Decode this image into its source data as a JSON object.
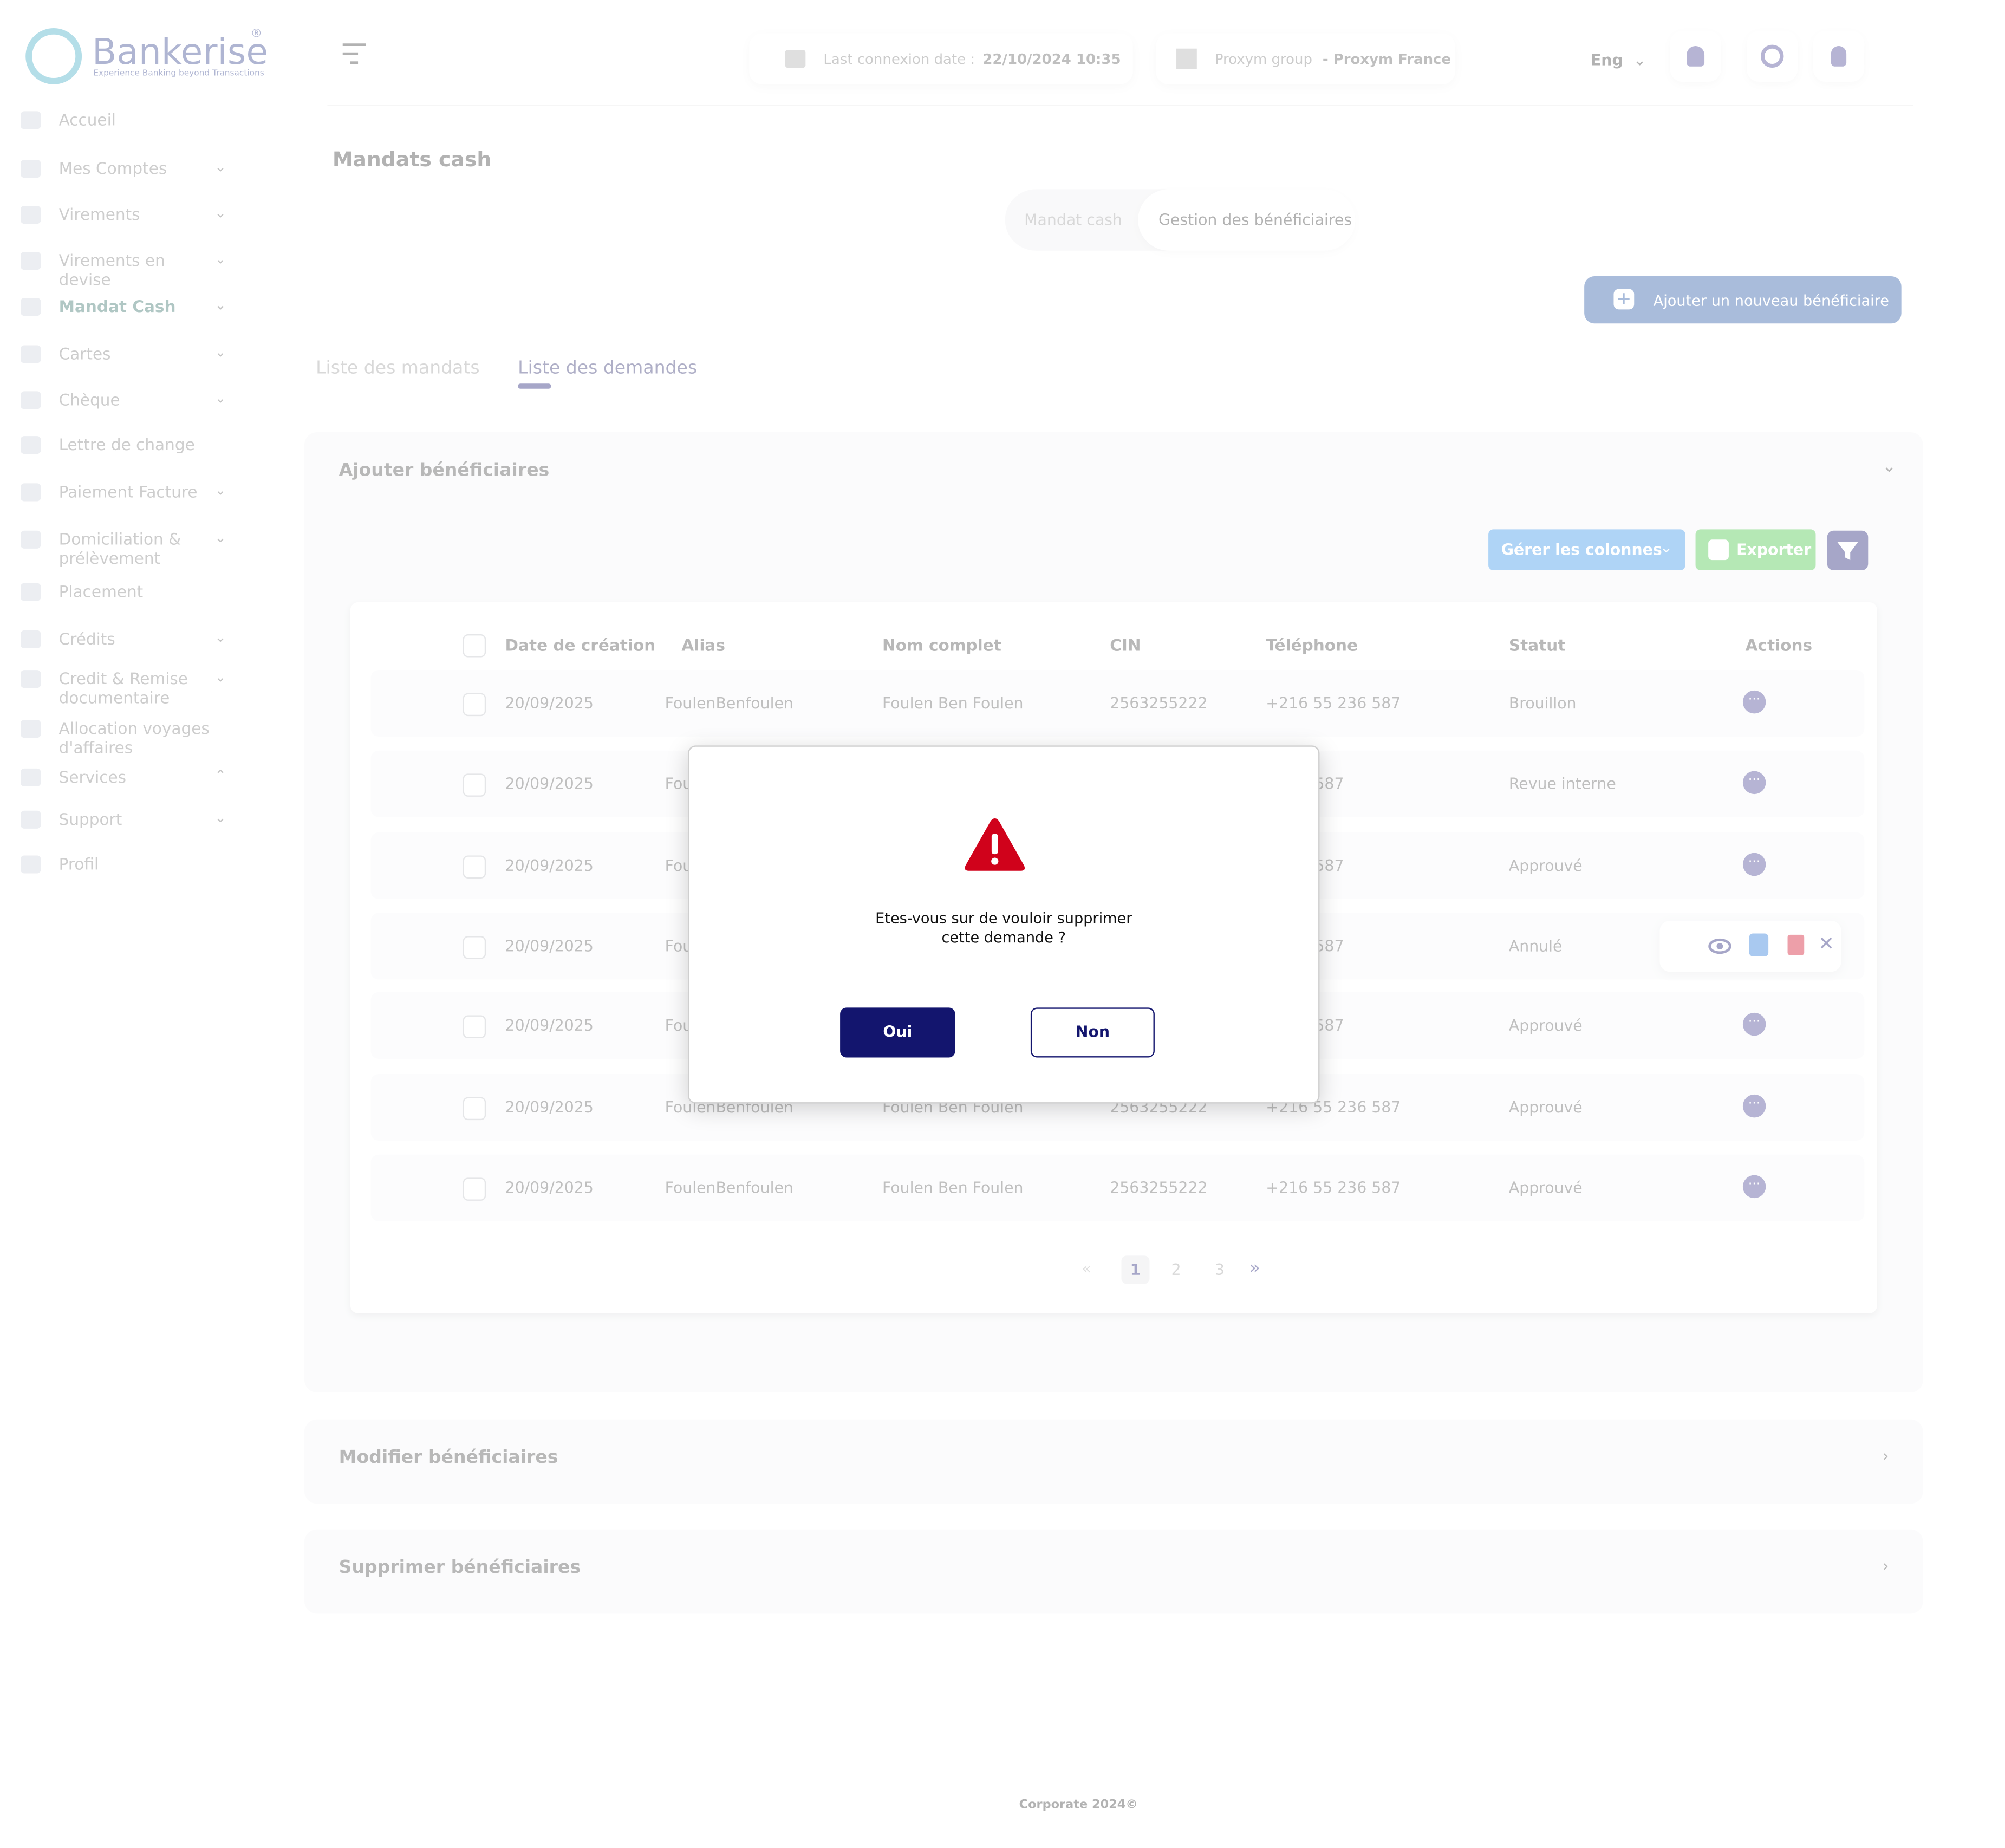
{
  "brand": {
    "name": "Bankerise",
    "tagline": "Experience Banking beyond Transactions",
    "registered": "®"
  },
  "sidebar": {
    "items": [
      {
        "label": "Accueil",
        "chev": ""
      },
      {
        "label": "Mes Comptes",
        "chev": "⌄"
      },
      {
        "label": "Virements",
        "chev": "⌄"
      },
      {
        "label": "Virements en devise",
        "chev": "⌄"
      },
      {
        "label": "Mandat Cash",
        "chev": "⌄"
      },
      {
        "label": "Cartes",
        "chev": "⌄"
      },
      {
        "label": "Chèque",
        "chev": "⌄"
      },
      {
        "label": "Lettre de change",
        "chev": ""
      },
      {
        "label": "Paiement Facture",
        "chev": "⌄"
      },
      {
        "label": "Domiciliation & prélèvement",
        "chev": "⌄"
      },
      {
        "label": "Placement",
        "chev": ""
      },
      {
        "label": "Crédits",
        "chev": "⌄"
      },
      {
        "label": "Credit & Remise documentaire",
        "chev": "⌄"
      },
      {
        "label": "Allocation voyages d'affaires",
        "chev": ""
      },
      {
        "label": "Services",
        "chev": "⌃"
      },
      {
        "label": "Support",
        "chev": "⌄"
      },
      {
        "label": "Profil",
        "chev": ""
      }
    ]
  },
  "header": {
    "last_connexion_label": "Last connexion date :",
    "last_connexion_value": "22/10/2024 10:35",
    "group_label": "Proxym group",
    "group_value": "- Proxym France",
    "language": "Eng"
  },
  "page": {
    "title": "Mandats cash",
    "segment_tabs": [
      "Mandat cash",
      "Gestion des bénéficiaires"
    ],
    "add_button": "Ajouter un nouveau bénéficiaire",
    "tabs": [
      "Liste des mandats",
      "Liste des demandes"
    ]
  },
  "section": {
    "title": "Ajouter  bénéficiaires",
    "manage_columns": "Gérer les colonnes",
    "export": "Exporter"
  },
  "table": {
    "headers": [
      "Date de création",
      "Alias",
      "Nom complet",
      "CIN",
      "Téléphone",
      "Statut",
      "Actions"
    ],
    "rows": [
      {
        "date": "20/09/2025",
        "alias": "FoulenBenfoulen",
        "name": "Foulen Ben Foulen",
        "cin": "2563255222",
        "phone": "+216 55 236 587",
        "status": "Brouillon"
      },
      {
        "date": "20/09/2025",
        "alias": "Fou",
        "name": "",
        "cin": "",
        "phone": "5 236 587",
        "status": "Revue interne"
      },
      {
        "date": "20/09/2025",
        "alias": "Fou",
        "name": "",
        "cin": "",
        "phone": "5 236 587",
        "status": "Approuvé"
      },
      {
        "date": "20/09/2025",
        "alias": "Fou",
        "name": "",
        "cin": "",
        "phone": "5 236 587",
        "status": "Annulé"
      },
      {
        "date": "20/09/2025",
        "alias": "Fou",
        "name": "",
        "cin": "",
        "phone": "5 236 587",
        "status": "Approuvé"
      },
      {
        "date": "20/09/2025",
        "alias": "FoulenBenfoulen",
        "name": "Foulen Ben Foulen",
        "cin": "2563255222",
        "phone": "+216 55 236 587",
        "status": "Approuvé"
      },
      {
        "date": "20/09/2025",
        "alias": "FoulenBenfoulen",
        "name": "Foulen Ben Foulen",
        "cin": "2563255222",
        "phone": "+216 55 236 587",
        "status": "Approuvé"
      }
    ],
    "pagination": {
      "first": "«",
      "pages": [
        "1",
        "2",
        "3"
      ],
      "last": "»"
    }
  },
  "accordions": [
    "Modifier bénéficiaires",
    "Supprimer bénéficiaires"
  ],
  "modal": {
    "message_line1": "Etes-vous sur de vouloir  supprimer",
    "message_line2": "cette demande  ?",
    "yes": "Oui",
    "no": "Non"
  },
  "footer": "Corporate 2024©",
  "colors": {
    "primary": "#13156e",
    "danger": "#d0021b",
    "accent_blue": "#3a6ab0",
    "teal": "#2d6a64"
  }
}
